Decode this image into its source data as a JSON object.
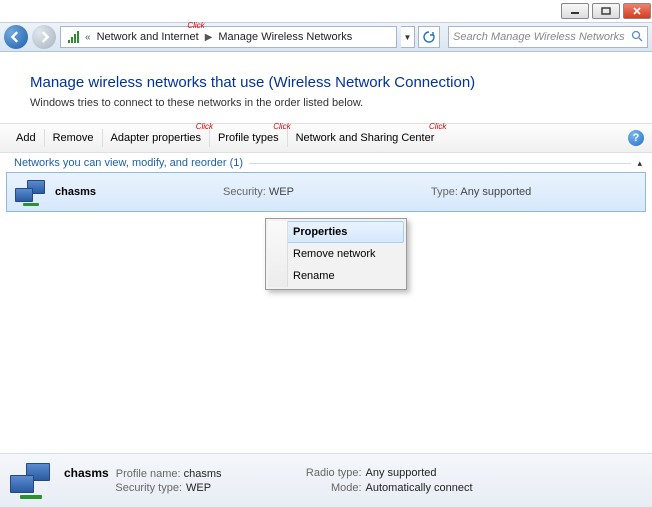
{
  "titlebar": {},
  "nav": {
    "crumb_prefix": "«",
    "crumb1": "Network and Internet",
    "crumb2": "Manage Wireless Networks",
    "search_placeholder": "Search Manage Wireless Networks"
  },
  "heading": "Manage wireless networks that use (Wireless Network Connection)",
  "sub_heading": "Windows tries to connect to these networks in the order listed below.",
  "click_tag": "Click",
  "toolbar": {
    "add": "Add",
    "remove": "Remove",
    "adapter": "Adapter properties",
    "profile": "Profile types",
    "center": "Network and Sharing Center"
  },
  "group_header": "Networks you can view, modify, and reorder (1)",
  "network": {
    "name": "chasms",
    "security_label": "Security:",
    "security_value": "WEP",
    "type_label": "Type:",
    "type_value": "Any supported"
  },
  "context_menu": {
    "properties": "Properties",
    "remove": "Remove network",
    "rename": "Rename"
  },
  "details": {
    "title": "chasms",
    "profile_name_label": "Profile name:",
    "profile_name_value": "chasms",
    "security_type_label": "Security type:",
    "security_type_value": "WEP",
    "radio_type_label": "Radio type:",
    "radio_type_value": "Any supported",
    "mode_label": "Mode:",
    "mode_value": "Automatically connect"
  }
}
